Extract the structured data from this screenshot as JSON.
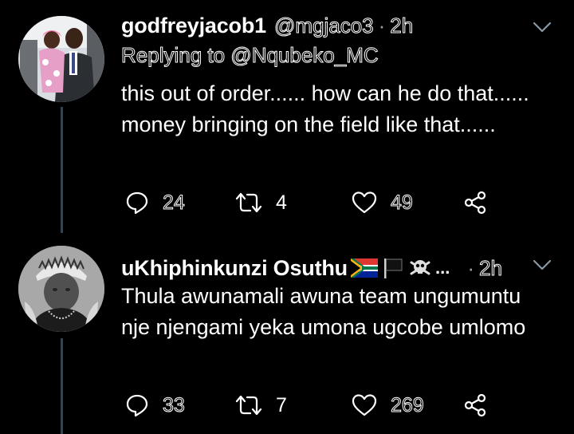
{
  "theme": {
    "background": "#000000",
    "text": "#ffffff",
    "muted": "#a0a0a0",
    "thread_line": "#38444d"
  },
  "tweets": [
    {
      "display_name": "godfreyjacob1",
      "handle": "@mgjaco3",
      "separator": "·",
      "time": "2h",
      "replying_to": "Replying to @Nqubeko_MC",
      "text": "this out of order......  how can he do that......  money bringing on the field like that......",
      "avatar_icon": "avatar-man-holding-child-photo",
      "actions": {
        "reply_count": "24",
        "retweet_count": "4",
        "like_count": "49"
      }
    },
    {
      "display_name": "uKhiphinkunzi Osuthu",
      "name_emojis": [
        "south-africa-flag-icon",
        "black-flag-icon",
        "skull-crossbones-icon"
      ],
      "name_truncation": "...",
      "separator": "·",
      "time": "2h",
      "text": "Thula awunamali awuna team ungumuntu nje njengami yeka umona ugcobe umlomo",
      "avatar_icon": "avatar-man-headdress-photo",
      "actions": {
        "reply_count": "33",
        "retweet_count": "7",
        "like_count": "269"
      }
    }
  ]
}
